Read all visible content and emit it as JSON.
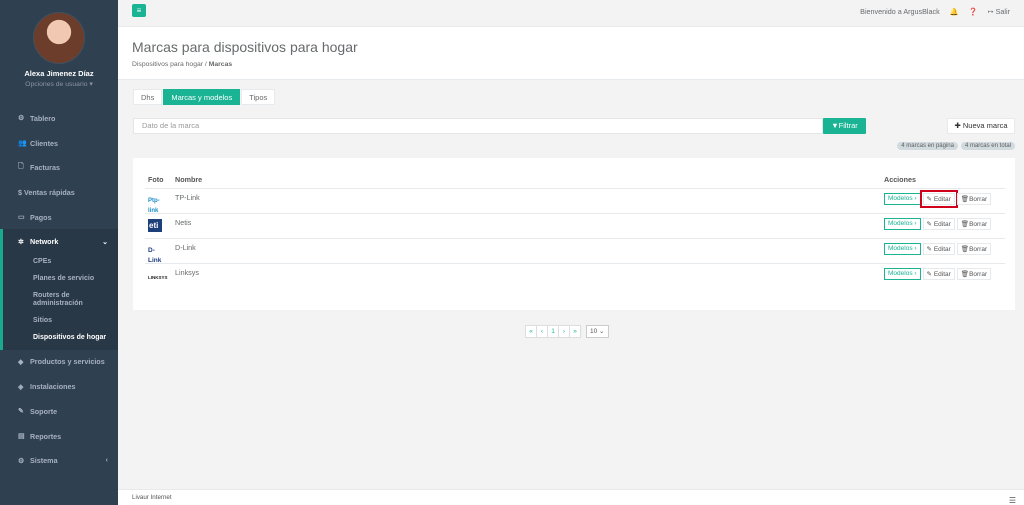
{
  "user": {
    "name": "Alexa Jimenez Díaz",
    "options": "Opciones de usuario ▾"
  },
  "sidebar": {
    "items": [
      {
        "label": "Tablero",
        "icon": "dashboard-icon"
      },
      {
        "label": "Clientes",
        "icon": "users-icon"
      },
      {
        "label": "Facturas",
        "icon": "invoice-icon"
      },
      {
        "label": "$ Ventas rápidas",
        "icon": ""
      },
      {
        "label": "Pagos",
        "icon": "payments-icon"
      },
      {
        "label": "Network",
        "icon": "network-icon"
      },
      {
        "label": "Productos y servicios",
        "icon": "tag-icon"
      },
      {
        "label": "Instalaciones",
        "icon": "install-icon"
      },
      {
        "label": "Soporte",
        "icon": "wrench-icon"
      },
      {
        "label": "Reportes",
        "icon": "reports-icon"
      },
      {
        "label": "Sistema",
        "icon": "settings-icon"
      }
    ],
    "network_sub": [
      "CPEs",
      "Planes de servicio",
      "Routers de administración",
      "Sitios",
      "Dispositivos de hogar"
    ]
  },
  "topbar": {
    "welcome": "Bienvenido a ArgusBlack",
    "logout": "Salir"
  },
  "header": {
    "title": "Marcas para dispositivos para hogar",
    "crumb_parent": "Dispositivos para hogar",
    "crumb_sep": "/",
    "crumb_current": "Marcas"
  },
  "tabs": [
    "Dhs",
    "Marcas y modelos",
    "Tipos"
  ],
  "filter": {
    "placeholder": "Dato de la marca",
    "button": "Filtrar",
    "new_button": "Nueva marca"
  },
  "counts": {
    "page": "4 marcas en página",
    "total": "4 marcas en total"
  },
  "table": {
    "headers": {
      "photo": "Foto",
      "name": "Nombre",
      "actions": "Acciones"
    },
    "rows": [
      {
        "logo": "Ptp-link",
        "name": "TP-Link"
      },
      {
        "logo": "eti",
        "name": "Netis"
      },
      {
        "logo": "D-Link",
        "name": "D-Link"
      },
      {
        "logo": "LINKSYS",
        "name": "Linksys"
      }
    ],
    "btn_models": "Modelos ›",
    "btn_edit": "Editar",
    "btn_delete": "Borrar"
  },
  "pagination": {
    "first": "«",
    "prev": "‹",
    "page": "1",
    "next": "›",
    "last": "»",
    "size": "10"
  },
  "footer": {
    "text": "Livaur Internet"
  },
  "colors": {
    "accent": "#1ab394",
    "sidebar": "#2f4050",
    "highlight": "#d0021b"
  }
}
